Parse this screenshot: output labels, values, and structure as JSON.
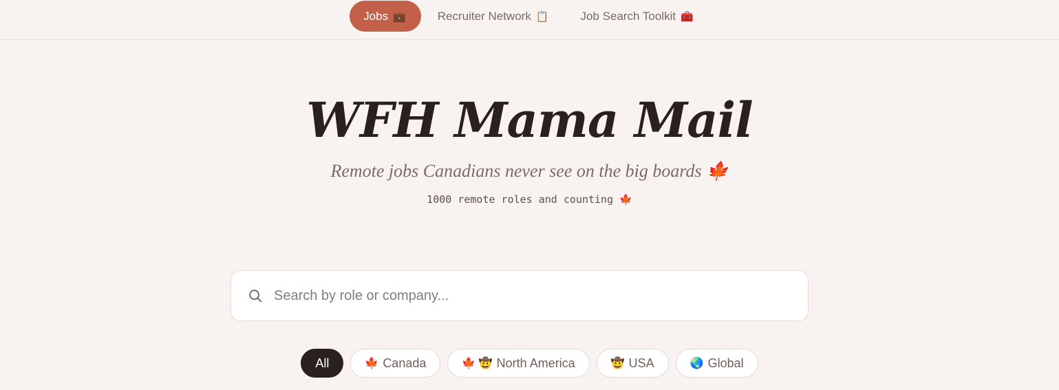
{
  "nav": {
    "tabs": [
      {
        "label": "Jobs",
        "icon": "💼"
      },
      {
        "label": "Recruiter Network",
        "icon": "📋"
      },
      {
        "label": "Job Search Toolkit",
        "icon": "🧰"
      }
    ]
  },
  "hero": {
    "title": "WFH Mama Mail",
    "subtitle": "Remote jobs Canadians never see on the big boards",
    "subtitle_icon": "🍁",
    "counter": "1000 remote roles and counting",
    "counter_icon": "🍁"
  },
  "search": {
    "placeholder": "Search by role or company..."
  },
  "filters": [
    {
      "label": "All",
      "icons": ""
    },
    {
      "label": "Canada",
      "icons": "🍁"
    },
    {
      "label": "North America",
      "icons": "🍁 🤠"
    },
    {
      "label": "USA",
      "icons": "🤠"
    },
    {
      "label": "Global",
      "icons": "🌏"
    }
  ],
  "colors": {
    "background": "#f8f3f0",
    "accent": "#c2604a",
    "dark": "#2a211e",
    "muted": "#7a6a66"
  }
}
